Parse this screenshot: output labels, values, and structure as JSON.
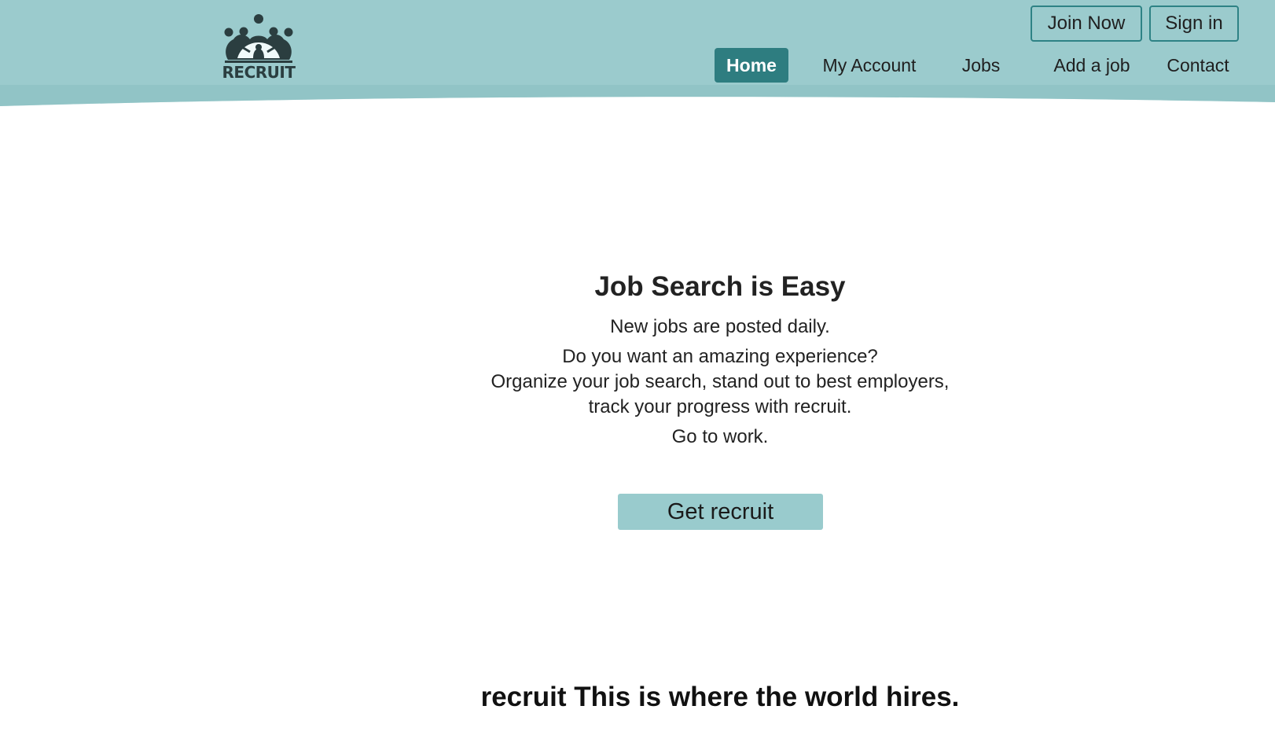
{
  "colors": {
    "header_bg": "#9bcbcd",
    "accent": "#2e7d80",
    "cta_bg": "#99cbcd"
  },
  "logo": {
    "icon": "recruit-logo-icon",
    "text": "RECRUIT"
  },
  "top_buttons": {
    "join": "Join Now",
    "signin": "Sign in"
  },
  "nav": {
    "items": [
      {
        "label": "Home",
        "active": true
      },
      {
        "label": "My Account",
        "active": false
      },
      {
        "label": "Jobs",
        "active": false
      },
      {
        "label": "Add a job",
        "active": false
      },
      {
        "label": "Contact",
        "active": false
      }
    ]
  },
  "hero": {
    "title": "Job Search is Easy",
    "line1": "New jobs are posted daily.",
    "line2": "Do you want an amazing experience?",
    "line3": "Organize your job search, stand out to best employers,",
    "line4": "track your progress with recruit.",
    "line5": "Go to work.",
    "cta": "Get recruit"
  },
  "tagline": {
    "brand": "recruit",
    "text": "This is where the world hires."
  }
}
